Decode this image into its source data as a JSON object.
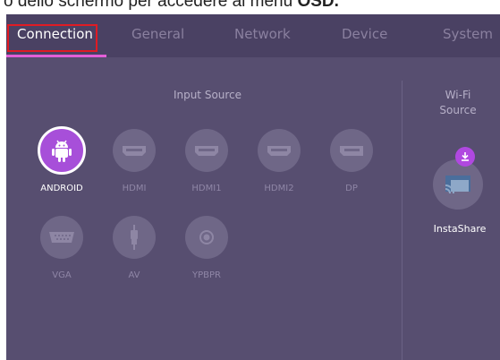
{
  "caption": {
    "text": "o dello schermo per accedere al menu ",
    "bold": "OSD."
  },
  "tabs": [
    {
      "label": "Connection",
      "active": true
    },
    {
      "label": "General",
      "active": false
    },
    {
      "label": "Network",
      "active": false
    },
    {
      "label": "Device",
      "active": false
    },
    {
      "label": "System",
      "active": false
    }
  ],
  "input_source": {
    "title": "Input Source",
    "items": [
      {
        "label": "ANDROID",
        "icon": "android-icon",
        "active": true
      },
      {
        "label": "HDMI",
        "icon": "hdmi-icon",
        "active": false
      },
      {
        "label": "HDMI1",
        "icon": "hdmi-icon",
        "active": false
      },
      {
        "label": "HDMI2",
        "icon": "hdmi-icon",
        "active": false
      },
      {
        "label": "DP",
        "icon": "displayport-icon",
        "active": false
      },
      {
        "label": "VGA",
        "icon": "vga-icon",
        "active": false
      },
      {
        "label": "AV",
        "icon": "av-icon",
        "active": false
      },
      {
        "label": "YPBPR",
        "icon": "ypbpr-icon",
        "active": false
      }
    ]
  },
  "wifi_source": {
    "title": "Wi-Fi Source",
    "item": {
      "label": "InstaShare",
      "icon": "instashare-icon",
      "badge_icon": "download-icon"
    }
  },
  "colors": {
    "background": "#574e70",
    "tabbar": "#4a4163",
    "active_source": "#a74fd9",
    "tab_underline": "#e35fd8",
    "highlight_box": "#e01b24"
  }
}
